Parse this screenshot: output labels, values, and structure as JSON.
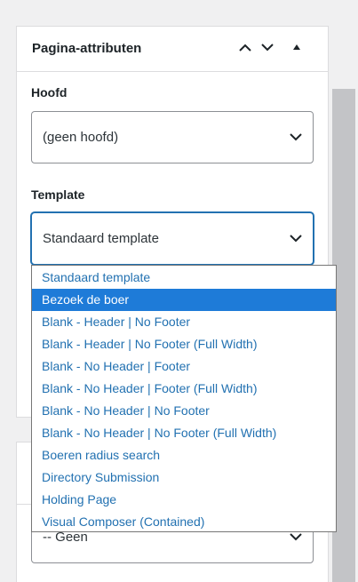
{
  "panel": {
    "title": "Pagina-attributen",
    "controls": [
      "chevron-up-icon",
      "chevron-down-icon",
      "triangle-up-icon"
    ]
  },
  "parent": {
    "label": "Hoofd",
    "value": "(geen hoofd)"
  },
  "template": {
    "label": "Template",
    "value": "Standaard template",
    "options": [
      "Standaard template",
      "Bezoek de boer",
      "Blank - Header | No Footer",
      "Blank - Header | No Footer (Full Width)",
      "Blank - No Header | Footer",
      "Blank - No Header | Footer (Full Width)",
      "Blank - No Header | No Footer",
      "Blank - No Header | No Footer (Full Width)",
      "Boeren radius search",
      "Directory Submission",
      "Holding Page",
      "Visual Composer (Contained)"
    ],
    "highlighted_option": "Bezoek de boer"
  },
  "lower_select": {
    "value": "-- Geen"
  },
  "colors": {
    "accent": "#2271b1",
    "highlight": "#1e7bd8",
    "panel_border": "#dcdcde"
  }
}
